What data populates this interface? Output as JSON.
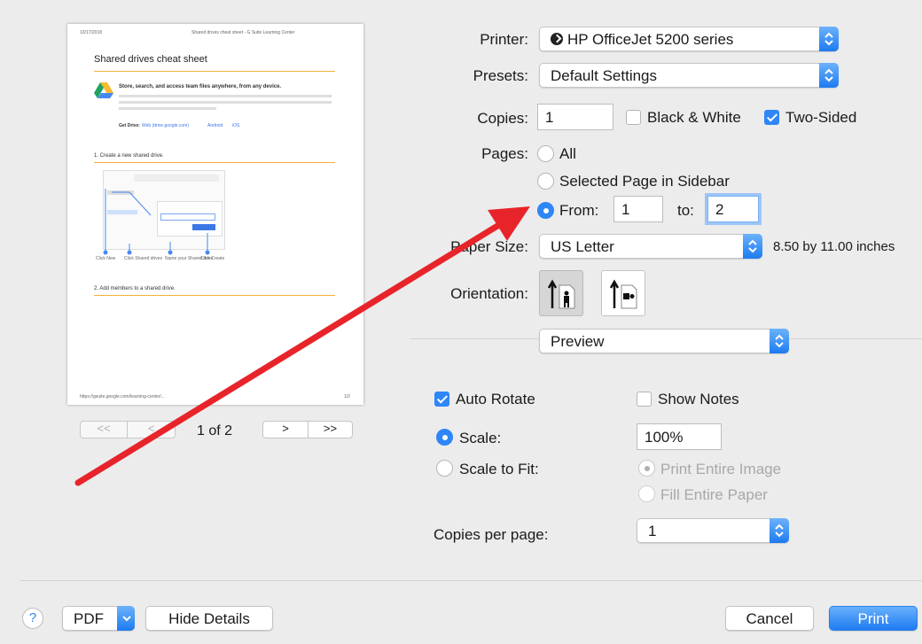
{
  "preview": {
    "header_date": "10/17/2018",
    "header_title": "Shared drives cheat sheet - G Suite Learning Center",
    "title": "Shared drives cheat sheet",
    "intro_heading": "Store, search, and access team files anywhere, from any device.",
    "get_drive": "Get Drive:",
    "links": [
      "Web (drive.google.com)",
      "Android",
      "iOS"
    ],
    "section1": "1. Create a new shared drive.",
    "step_labels": [
      "Click New",
      "Click Shared drives",
      "Name your Shared drive",
      "Click Create"
    ],
    "section2": "2. Add members to a shared drive.",
    "footer_url": "https://gsuite.google.com/learning-center/...",
    "footer_page": "1/2",
    "page_indicator": "1 of 2",
    "nav": {
      "first": "<<",
      "prev": "<",
      "next": ">",
      "last": ">>"
    }
  },
  "printer": {
    "label": "Printer:",
    "value": "HP OfficeJet 5200 series"
  },
  "presets": {
    "label": "Presets:",
    "value": "Default Settings"
  },
  "copies": {
    "label": "Copies:",
    "value": "1",
    "bw_label": "Black & White",
    "bw_checked": false,
    "two_sided_label": "Two-Sided",
    "two_sided_checked": true
  },
  "pages": {
    "label": "Pages:",
    "all": "All",
    "selected": "Selected Page in Sidebar",
    "from_label": "From:",
    "from_value": "1",
    "to_label": "to:",
    "to_value": "2",
    "selected_option": "from"
  },
  "paper_size": {
    "label": "Paper Size:",
    "value": "US Letter",
    "dimensions": "8.50 by 11.00 inches"
  },
  "orientation": {
    "label": "Orientation:",
    "selected": "portrait"
  },
  "section_popup": {
    "value": "Preview"
  },
  "preview_opts": {
    "auto_rotate": "Auto Rotate",
    "auto_rotate_checked": true,
    "show_notes": "Show Notes",
    "show_notes_checked": false,
    "scale": "Scale:",
    "scale_value": "100%",
    "scale_selected": true,
    "scale_to_fit": "Scale to Fit:",
    "print_entire_image": "Print Entire Image",
    "fill_entire_paper": "Fill Entire Paper",
    "copies_per_page": "Copies per page:",
    "copies_per_page_value": "1"
  },
  "footer": {
    "help": "?",
    "pdf": "PDF",
    "hide_details": "Hide Details",
    "cancel": "Cancel",
    "print": "Print"
  },
  "annotation": {
    "arrow_color": "#e8242b"
  },
  "colors": {
    "accent": "#2f86f6",
    "background": "#ececec"
  }
}
